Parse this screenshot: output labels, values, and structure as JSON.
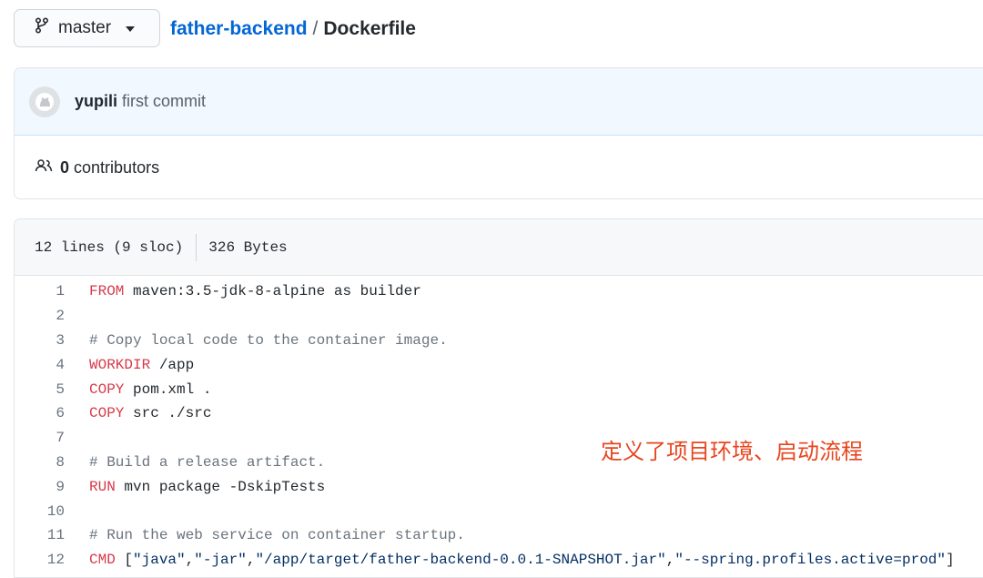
{
  "branch": {
    "name": "master",
    "icon": "git-branch-icon"
  },
  "breadcrumb": {
    "repo": "father-backend",
    "separator": "/",
    "file": "Dockerfile"
  },
  "commit": {
    "author": "yupili",
    "message": "first commit"
  },
  "contributors": {
    "count": "0",
    "label": "contributors"
  },
  "file_info": {
    "lines": "12 lines (9 sloc)",
    "size": "326 Bytes"
  },
  "code_lines": [
    {
      "n": "1",
      "kw": "FROM",
      "rest": " maven:3.5-jdk-8-alpine as builder"
    },
    {
      "n": "2",
      "kw": "",
      "rest": ""
    },
    {
      "n": "3",
      "comment": "# Copy local code to the container image."
    },
    {
      "n": "4",
      "kw": "WORKDIR",
      "rest": " /app"
    },
    {
      "n": "5",
      "kw": "COPY",
      "rest": " pom.xml ."
    },
    {
      "n": "6",
      "kw": "COPY",
      "rest": " src ./src"
    },
    {
      "n": "7",
      "kw": "",
      "rest": ""
    },
    {
      "n": "8",
      "comment": "# Build a release artifact."
    },
    {
      "n": "9",
      "kw": "RUN",
      "rest": " mvn package -DskipTests"
    },
    {
      "n": "10",
      "kw": "",
      "rest": ""
    },
    {
      "n": "11",
      "comment": "# Run the web service on container startup."
    },
    {
      "n": "12",
      "kw": "CMD",
      "cmd": true,
      "args": [
        "\"java\"",
        "\"-jar\"",
        "\"/app/target/father-backend-0.0.1-SNAPSHOT.jar\"",
        "\"--spring.profiles.active=prod\""
      ]
    }
  ],
  "annotation": "定义了项目环境、启动流程",
  "colors": {
    "keyword": "#d73a49",
    "comment": "#6a737d",
    "string": "#032f62",
    "link": "#0366d6",
    "annotation": "#e8461f"
  }
}
